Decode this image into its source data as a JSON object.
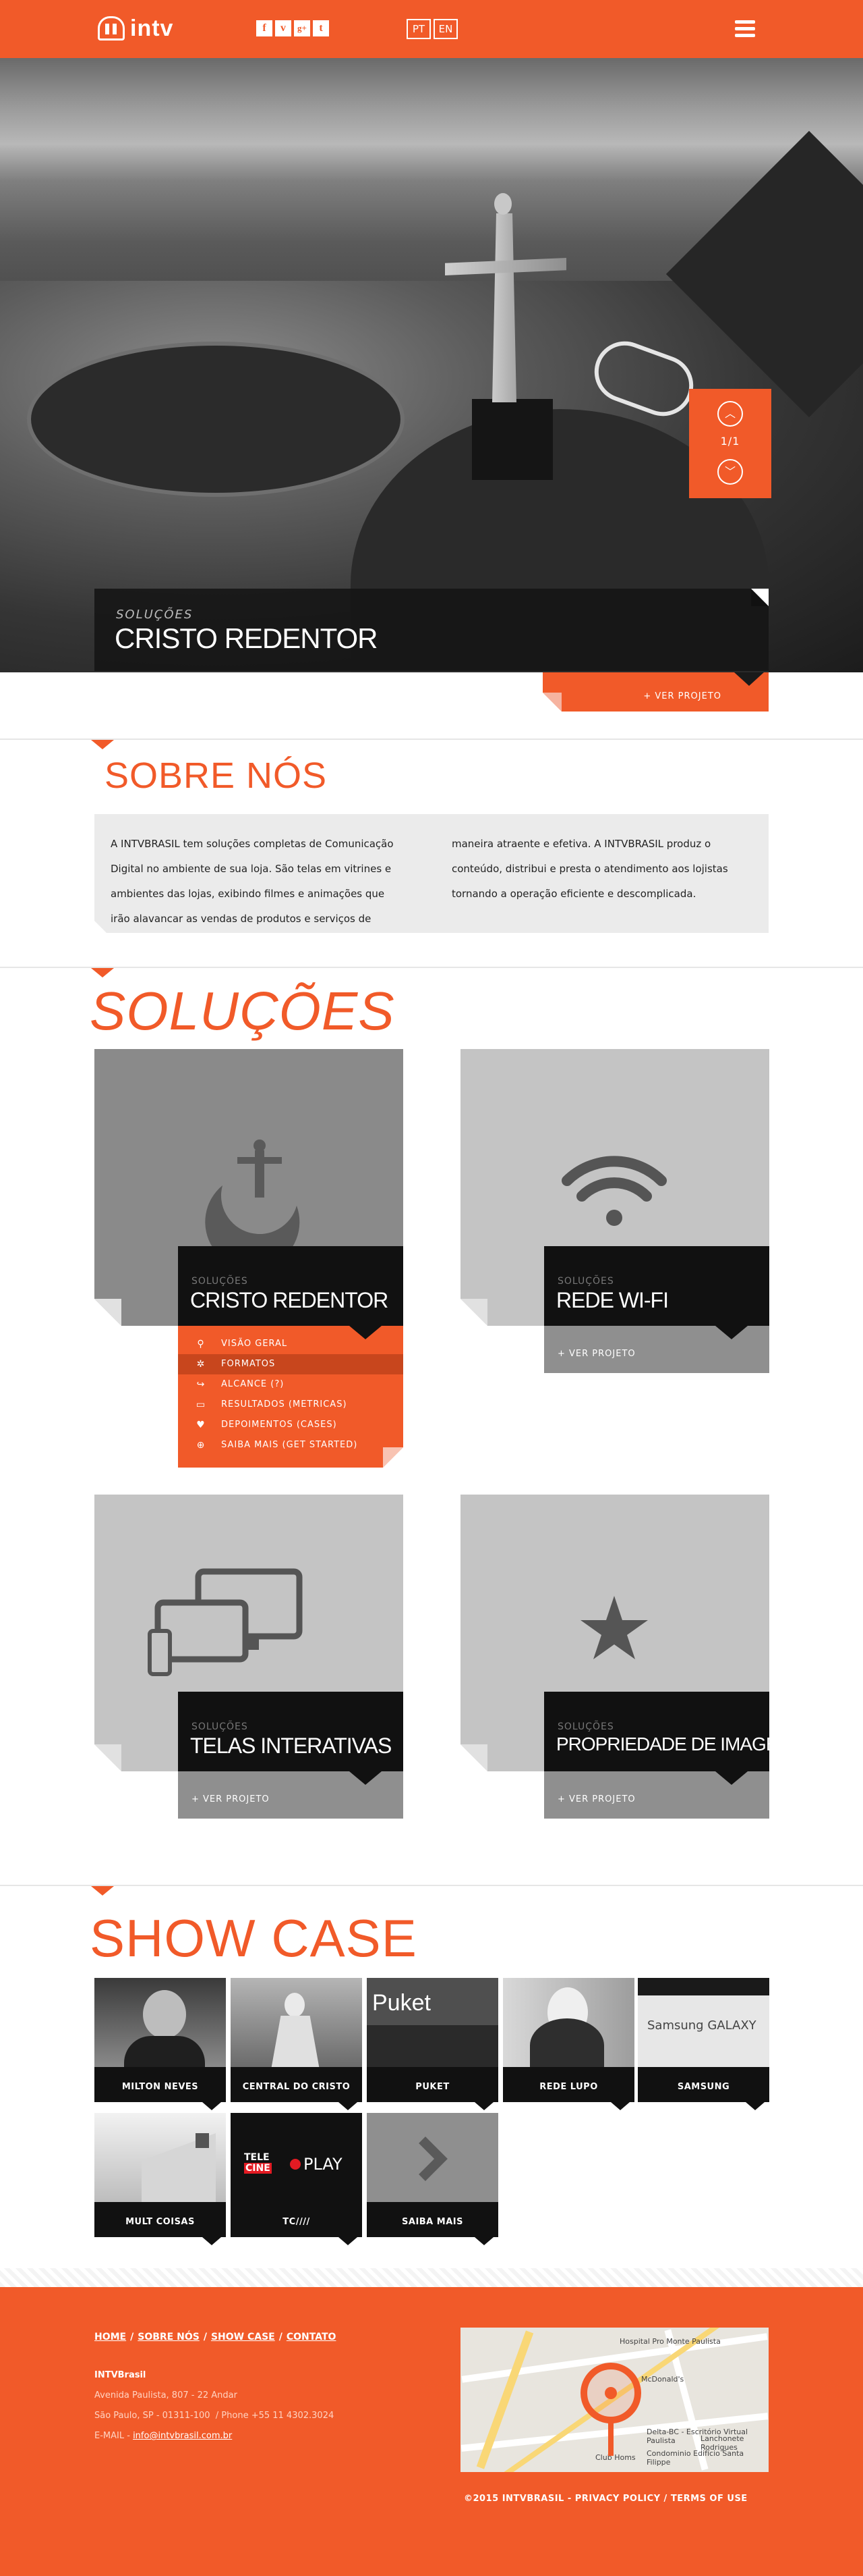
{
  "brand": {
    "name": "intv"
  },
  "social": [
    {
      "icon": "facebook-icon",
      "glyph": "f"
    },
    {
      "icon": "vimeo-icon",
      "glyph": "v"
    },
    {
      "icon": "google-plus-icon",
      "glyph": "g+"
    },
    {
      "icon": "tumblr-icon",
      "glyph": "t"
    }
  ],
  "languages": [
    "PT",
    "EN"
  ],
  "hero": {
    "counter": "1/1",
    "kicker": "SOLUÇÕES",
    "title": "CRISTO REDENTOR",
    "link": "+ VER PROJETO"
  },
  "sobre": {
    "title": "SOBRE NÓS",
    "col1": "A INTVBRASIL tem soluções completas de Comunicação Digital no ambiente de sua loja. São telas em vitrines e ambientes das lojas, exibindo filmes e animações que irão alavancar as vendas de produtos e serviços de",
    "col2": "maneira atraente e efetiva. A INTVBRASIL produz o conteúdo, distribui e presta o atendimento aos lojistas tornando a operação eficiente e descomplicada."
  },
  "solucoes": {
    "title": "SOLUÇÕES",
    "cards": [
      {
        "kicker": "SOLUÇÕES",
        "title": "CRISTO REDENTOR",
        "icon": "cristo-redentor-icon"
      },
      {
        "kicker": "SOLUÇÕES",
        "title": "REDE WI-FI",
        "link": "+ VER PROJETO",
        "icon": "wifi-icon"
      },
      {
        "kicker": "SOLUÇÕES",
        "title": "TELAS INTERATIVAS",
        "link": "+ VER PROJETO",
        "icon": "devices-icon"
      },
      {
        "kicker": "SOLUÇÕES",
        "title": "PROPRIEDADE DE IMAGEM",
        "link": "+ VER PROJETO",
        "icon": "star-icon"
      }
    ],
    "submenu": [
      {
        "label": "VISÃO GERAL",
        "icon": "link-icon",
        "glyph": "⚲"
      },
      {
        "label": "FORMATOS",
        "icon": "gear-icon",
        "glyph": "✲"
      },
      {
        "label": "ALCANCE (?)",
        "icon": "share-icon",
        "glyph": "↪"
      },
      {
        "label": "RESULTADOS (METRICAS)",
        "icon": "folder-icon",
        "glyph": "▭"
      },
      {
        "label": "DEPOIMENTOS (CASES)",
        "icon": "heart-icon",
        "glyph": "♥"
      },
      {
        "label": "SAIBA MAIS (GET STARTED)",
        "icon": "plus-circle-icon",
        "glyph": "⊕"
      }
    ]
  },
  "showcase": {
    "title": "SHOW CASE",
    "tiles": [
      {
        "label": "MILTON NEVES"
      },
      {
        "label": "CENTRAL DO CRISTO"
      },
      {
        "label": "PUKET",
        "logo": "Puket"
      },
      {
        "label": "REDE LUPO"
      },
      {
        "label": "SAMSUNG",
        "logo": "Samsung GALAXY"
      },
      {
        "label": "MULT COISAS"
      },
      {
        "label": "TC////",
        "logo_a": "TELE",
        "logo_b": "CINE",
        "logo_c": "PLAY"
      },
      {
        "label": "SAIBA MAIS"
      }
    ]
  },
  "footer": {
    "nav": [
      "HOME",
      "SOBRE NÓS",
      "SHOW CASE",
      "CONTATO"
    ],
    "company": "INTVBrasil",
    "address": "Avenida Paulista, 807 - 22 Andar",
    "city": "São Paulo, SP - 01311-100",
    "phone": "/ Phone +55 11 4302.3024",
    "email_label": "E-MAIL -",
    "email": "info@intvbrasil.com.br",
    "copyright": "©2015 INTVBRASIL",
    "privacy": "PRIVACY POLICY",
    "terms": "TERMS OF USE",
    "map_labels": [
      "Hospital Pro Monte Paulista",
      "McDonald's",
      "Delta-BC - Escritório Virtual Paulista",
      "Condominio Edifício Santa Filippe",
      "Club Homs",
      "Lanchonete Rodrigues"
    ]
  },
  "colors": {
    "accent": "#f15a29",
    "dark": "#111111",
    "light": "#ebebeb"
  }
}
